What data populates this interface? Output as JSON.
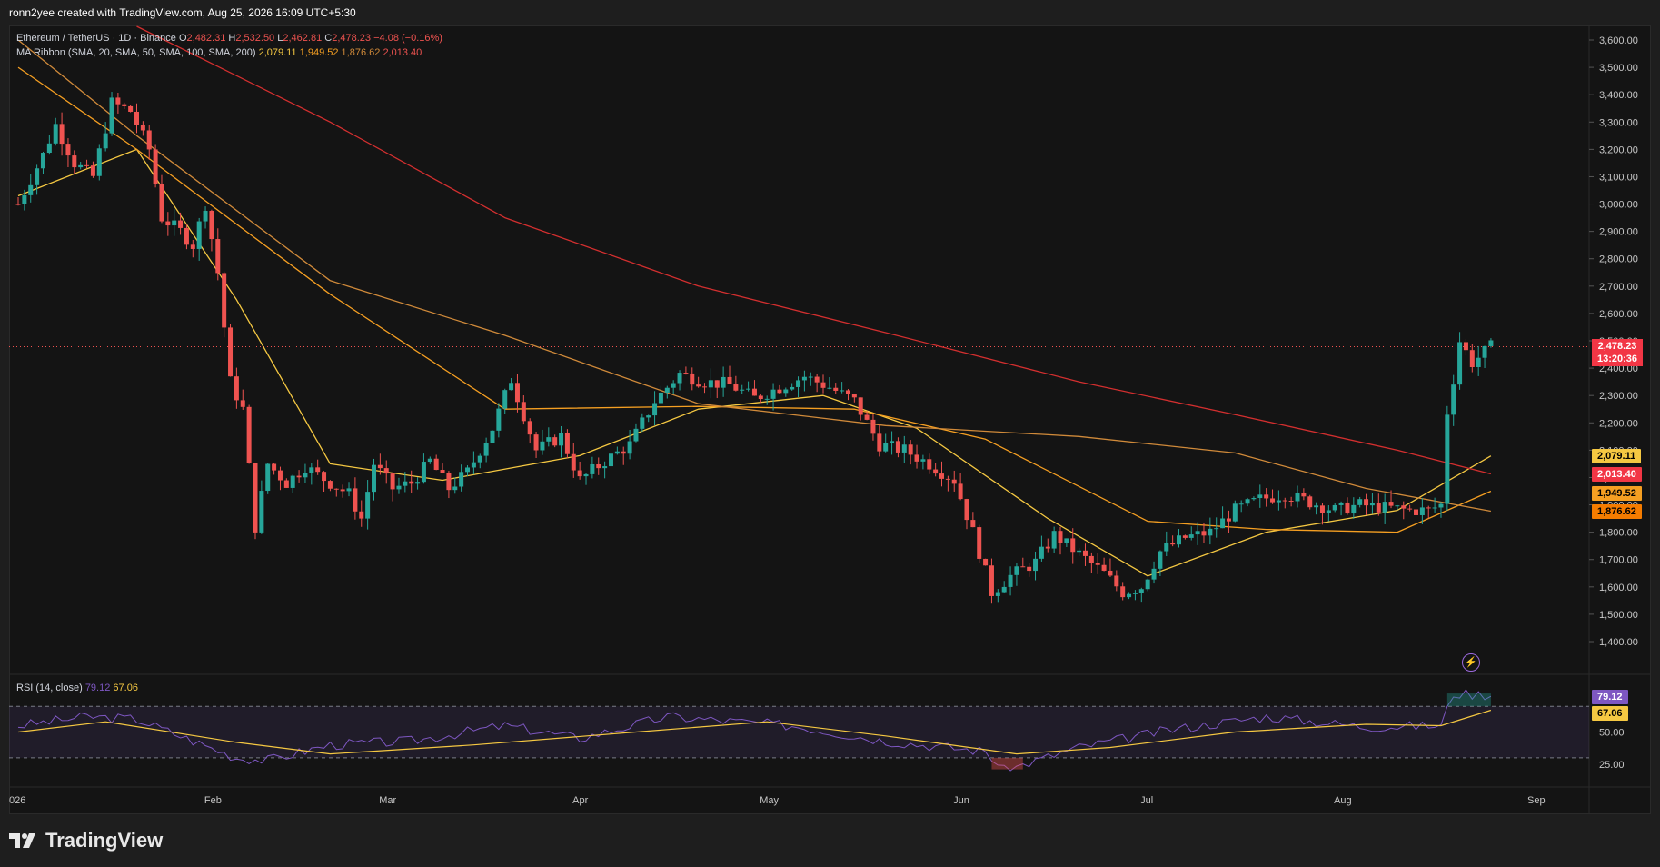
{
  "topbar": {
    "text": "ronn2yee created with TradingView.com, Aug 25, 2026 16:09 UTC+5:30"
  },
  "legend": {
    "symbol": "Ethereum / TetherUS · 1D · Binance",
    "ohlc": {
      "o_label": "O",
      "o": "2,482.31",
      "h_label": "H",
      "h": "2,532.50",
      "l_label": "L",
      "l": "2,462.81",
      "c_label": "C",
      "c": "2,478.23",
      "chg": "−4.08 (−0.16%)"
    },
    "ma_ribbon": "MA Ribbon (SMA, 20, SMA, 50, SMA, 100, SMA, 200)",
    "ma_values": [
      "2,079.11",
      "1,949.52",
      "1,876.62",
      "2,013.40"
    ],
    "rsi": "RSI (14, close)",
    "rsi_values": [
      "79.12",
      "67.06"
    ]
  },
  "price_axis": {
    "ticks": [
      "3,600.00",
      "3,500.00",
      "3,400.00",
      "3,300.00",
      "3,200.00",
      "3,100.00",
      "3,000.00",
      "2,900.00",
      "2,800.00",
      "2,700.00",
      "2,600.00",
      "2,500.00",
      "2,400.00",
      "2,300.00",
      "2,200.00",
      "2,100.00",
      "2,000.00",
      "1,900.00",
      "1,800.00",
      "1,700.00",
      "1,600.00",
      "1,500.00",
      "1,400.00"
    ],
    "labels": [
      {
        "text": "2,478.23",
        "sub": "13:20:36",
        "color": "#f23645",
        "value": 2478.23
      },
      {
        "text": "2,079.11",
        "color": "#f5c842",
        "value": 2079.11
      },
      {
        "text": "2,013.40",
        "color": "#f23645",
        "value": 2013.4
      },
      {
        "text": "1,949.52",
        "color": "#f59f22",
        "value": 1949.52
      },
      {
        "text": "1,876.62",
        "color": "#f57c00",
        "value": 1876.62
      }
    ]
  },
  "rsi_axis": {
    "ticks": [
      "50.00",
      "25.00"
    ],
    "labels": [
      {
        "text": "79.12",
        "color": "#7e57c2",
        "value": 79.12
      },
      {
        "text": "67.06",
        "color": "#f5c842",
        "value": 67.06
      }
    ]
  },
  "time_axis": [
    "026",
    "Feb",
    "Mar",
    "Apr",
    "May",
    "Jun",
    "Jul",
    "Aug",
    "Sep"
  ],
  "brand": "TradingView",
  "colors": {
    "up": "#26a69a",
    "down": "#ef5350",
    "ma20": "#f5c842",
    "ma50": "#f59f22",
    "ma100": "#d08a3a",
    "ma200": "#d32f2f",
    "rsi": "#7e57c2",
    "rsi_ma": "#f5c842"
  },
  "chart_data": {
    "type": "candlestick",
    "symbol": "Ethereum / TetherUS",
    "interval": "1D",
    "ylim": [
      1400,
      3600
    ],
    "x_range": [
      "2026-01-01",
      "2026-09-01"
    ],
    "anchors": [
      [
        "2026-01-01",
        3000
      ],
      [
        "2026-01-05",
        3180
      ],
      [
        "2026-01-07",
        3290
      ],
      [
        "2026-01-10",
        3150
      ],
      [
        "2026-01-13",
        3100
      ],
      [
        "2026-01-16",
        3370
      ],
      [
        "2026-01-19",
        3340
      ],
      [
        "2026-01-22",
        3200
      ],
      [
        "2026-01-24",
        2950
      ],
      [
        "2026-01-27",
        2900
      ],
      [
        "2026-01-29",
        2850
      ],
      [
        "2026-01-31",
        3000
      ],
      [
        "2026-02-02",
        2750
      ],
      [
        "2026-02-04",
        2350
      ],
      [
        "2026-02-06",
        2250
      ],
      [
        "2026-02-08",
        1820
      ],
      [
        "2026-02-10",
        2050
      ],
      [
        "2026-02-13",
        1980
      ],
      [
        "2026-02-16",
        2040
      ],
      [
        "2026-02-20",
        1980
      ],
      [
        "2026-02-23",
        1940
      ],
      [
        "2026-02-25",
        1850
      ],
      [
        "2026-02-27",
        2050
      ],
      [
        "2026-03-02",
        1960
      ],
      [
        "2026-03-05",
        1980
      ],
      [
        "2026-03-08",
        2060
      ],
      [
        "2026-03-11",
        1960
      ],
      [
        "2026-03-14",
        2020
      ],
      [
        "2026-03-18",
        2180
      ],
      [
        "2026-03-21",
        2360
      ],
      [
        "2026-03-25",
        2100
      ],
      [
        "2026-03-29",
        2150
      ],
      [
        "2026-04-01",
        1990
      ],
      [
        "2026-04-05",
        2060
      ],
      [
        "2026-04-09",
        2120
      ],
      [
        "2026-04-13",
        2280
      ],
      [
        "2026-04-17",
        2380
      ],
      [
        "2026-04-21",
        2350
      ],
      [
        "2026-04-25",
        2340
      ],
      [
        "2026-04-29",
        2290
      ],
      [
        "2026-05-03",
        2330
      ],
      [
        "2026-05-07",
        2370
      ],
      [
        "2026-05-11",
        2330
      ],
      [
        "2026-05-15",
        2280
      ],
      [
        "2026-05-19",
        2120
      ],
      [
        "2026-05-23",
        2100
      ],
      [
        "2026-05-27",
        2050
      ],
      [
        "2026-05-31",
        1990
      ],
      [
        "2026-06-03",
        1800
      ],
      [
        "2026-06-06",
        1580
      ],
      [
        "2026-06-09",
        1640
      ],
      [
        "2026-06-13",
        1690
      ],
      [
        "2026-06-16",
        1790
      ],
      [
        "2026-06-20",
        1720
      ],
      [
        "2026-06-24",
        1650
      ],
      [
        "2026-06-27",
        1580
      ],
      [
        "2026-06-30",
        1600
      ],
      [
        "2026-07-03",
        1730
      ],
      [
        "2026-07-07",
        1780
      ],
      [
        "2026-07-11",
        1800
      ],
      [
        "2026-07-15",
        1880
      ],
      [
        "2026-07-19",
        1920
      ],
      [
        "2026-07-23",
        1940
      ],
      [
        "2026-07-27",
        1910
      ],
      [
        "2026-07-31",
        1880
      ],
      [
        "2026-08-04",
        1900
      ],
      [
        "2026-08-08",
        1890
      ],
      [
        "2026-08-12",
        1880
      ],
      [
        "2026-08-15",
        1880
      ],
      [
        "2026-08-17",
        1900
      ],
      [
        "2026-08-18",
        2240
      ],
      [
        "2026-08-19",
        2360
      ],
      [
        "2026-08-20",
        2500
      ],
      [
        "2026-08-22",
        2420
      ],
      [
        "2026-08-25",
        2478
      ]
    ],
    "ma_series": [
      {
        "name": "SMA 20",
        "color": "#f5c842",
        "points": [
          [
            "2026-01-01",
            3030
          ],
          [
            "2026-01-20",
            3200
          ],
          [
            "2026-02-05",
            2650
          ],
          [
            "2026-02-20",
            2050
          ],
          [
            "2026-03-10",
            1990
          ],
          [
            "2026-04-01",
            2080
          ],
          [
            "2026-04-20",
            2250
          ],
          [
            "2026-05-10",
            2300
          ],
          [
            "2026-05-25",
            2180
          ],
          [
            "2026-06-15",
            1850
          ],
          [
            "2026-07-01",
            1640
          ],
          [
            "2026-07-20",
            1800
          ],
          [
            "2026-08-10",
            1880
          ],
          [
            "2026-08-25",
            2079
          ]
        ]
      },
      {
        "name": "SMA 50",
        "color": "#f59f22",
        "points": [
          [
            "2026-01-01",
            3500
          ],
          [
            "2026-01-20",
            3200
          ],
          [
            "2026-02-20",
            2670
          ],
          [
            "2026-03-20",
            2250
          ],
          [
            "2026-04-20",
            2260
          ],
          [
            "2026-05-15",
            2250
          ],
          [
            "2026-06-05",
            2140
          ],
          [
            "2026-07-01",
            1840
          ],
          [
            "2026-07-20",
            1810
          ],
          [
            "2026-08-10",
            1800
          ],
          [
            "2026-08-25",
            1950
          ]
        ]
      },
      {
        "name": "SMA 100",
        "color": "#d08a3a",
        "points": [
          [
            "2026-01-01",
            3600
          ],
          [
            "2026-01-20",
            3250
          ],
          [
            "2026-02-20",
            2720
          ],
          [
            "2026-03-20",
            2520
          ],
          [
            "2026-04-20",
            2270
          ],
          [
            "2026-05-20",
            2190
          ],
          [
            "2026-06-20",
            2150
          ],
          [
            "2026-07-15",
            2090
          ],
          [
            "2026-08-05",
            1960
          ],
          [
            "2026-08-25",
            1877
          ]
        ]
      },
      {
        "name": "SMA 200",
        "color": "#d32f2f",
        "points": [
          [
            "2026-01-20",
            3650
          ],
          [
            "2026-02-20",
            3300
          ],
          [
            "2026-03-20",
            2950
          ],
          [
            "2026-04-20",
            2700
          ],
          [
            "2026-05-20",
            2530
          ],
          [
            "2026-06-20",
            2350
          ],
          [
            "2026-07-15",
            2230
          ],
          [
            "2026-08-10",
            2100
          ],
          [
            "2026-08-25",
            2013
          ]
        ]
      }
    ],
    "rsi_series": [
      {
        "name": "RSI",
        "points": [
          [
            "2026-01-01",
            55
          ],
          [
            "2026-01-12",
            62
          ],
          [
            "2026-01-20",
            60
          ],
          [
            "2026-01-28",
            45
          ],
          [
            "2026-02-05",
            30
          ],
          [
            "2026-02-10",
            28
          ],
          [
            "2026-02-20",
            40
          ],
          [
            "2026-03-05",
            43
          ],
          [
            "2026-03-20",
            55
          ],
          [
            "2026-04-01",
            45
          ],
          [
            "2026-04-15",
            62
          ],
          [
            "2026-05-05",
            55
          ],
          [
            "2026-05-20",
            43
          ],
          [
            "2026-06-05",
            35
          ],
          [
            "2026-06-08",
            20
          ],
          [
            "2026-06-20",
            38
          ],
          [
            "2026-07-05",
            52
          ],
          [
            "2026-07-20",
            62
          ],
          [
            "2026-08-05",
            54
          ],
          [
            "2026-08-17",
            55
          ],
          [
            "2026-08-19",
            80
          ],
          [
            "2026-08-25",
            79
          ]
        ]
      },
      {
        "name": "RSI-based MA",
        "points": [
          [
            "2026-01-01",
            50
          ],
          [
            "2026-01-15",
            58
          ],
          [
            "2026-02-05",
            42
          ],
          [
            "2026-02-20",
            33
          ],
          [
            "2026-03-15",
            40
          ],
          [
            "2026-04-10",
            50
          ],
          [
            "2026-05-01",
            58
          ],
          [
            "2026-05-20",
            47
          ],
          [
            "2026-06-10",
            33
          ],
          [
            "2026-06-25",
            38
          ],
          [
            "2026-07-15",
            50
          ],
          [
            "2026-08-05",
            56
          ],
          [
            "2026-08-17",
            55
          ],
          [
            "2026-08-25",
            67
          ]
        ]
      }
    ],
    "rsi_ylim": [
      20,
      85
    ],
    "rsi_bands": [
      30,
      50,
      70
    ]
  }
}
